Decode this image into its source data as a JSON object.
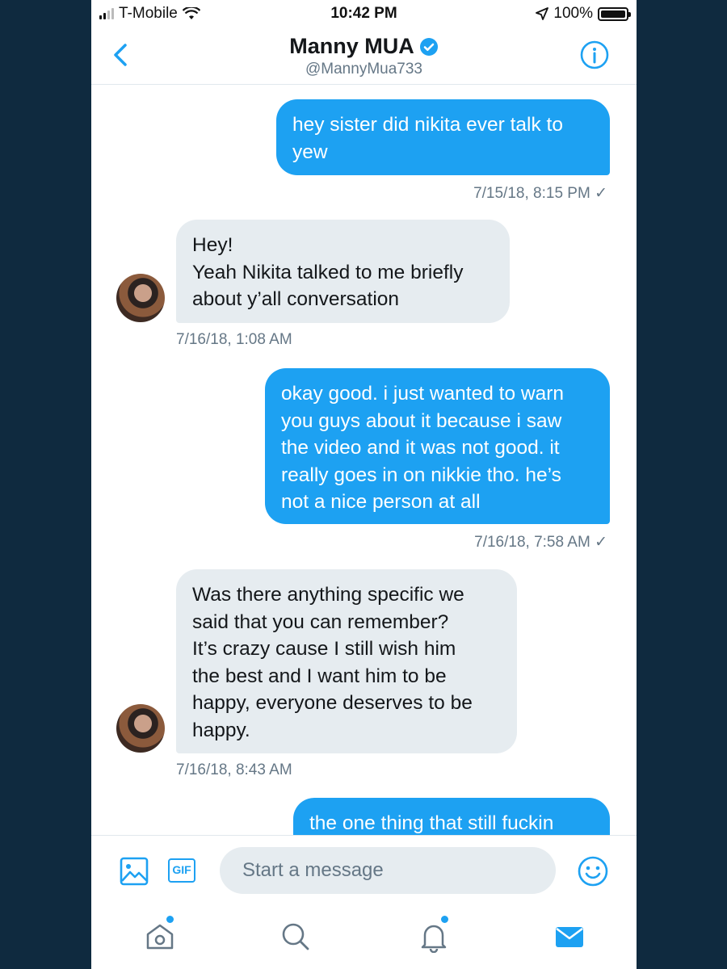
{
  "status_bar": {
    "carrier": "T-Mobile",
    "time": "10:42 PM",
    "battery": "100%"
  },
  "header": {
    "name": "Manny MUA",
    "handle": "@MannyMua733"
  },
  "messages": [
    {
      "direction": "out",
      "lines": [
        "hey sister did nikita ever talk to",
        "yew"
      ],
      "timestamp": "7/15/18, 8:15 PM ✓"
    },
    {
      "direction": "in",
      "lines": [
        "Hey!",
        "Yeah Nikita talked to me briefly",
        "about y’all conversation"
      ],
      "timestamp": "7/16/18, 1:08 AM"
    },
    {
      "direction": "out",
      "lines": [
        "okay good. i just wanted to warn",
        "you guys about it because i saw",
        "the video and it was not good. it",
        "really goes in on nikkie tho. he’s",
        "not a nice person at all"
      ],
      "timestamp": "7/16/18, 7:58 AM ✓"
    },
    {
      "direction": "in",
      "lines": [
        "Was there anything specific we",
        "said that you can remember?",
        "It’s crazy cause I still wish him",
        "the best and I want him to be",
        "happy, everyone deserves to be",
        "happy."
      ],
      "timestamp": "7/16/18, 8:43 AM"
    },
    {
      "direction": "out",
      "lines": [
        "the one thing that still fuckin"
      ]
    }
  ],
  "composer": {
    "placeholder": "Start a message",
    "gif_label": "GIF"
  },
  "colors": {
    "accent": "#1da1f2",
    "incoming_bubble": "#e6ecf0",
    "background": "#0f2a3f"
  }
}
